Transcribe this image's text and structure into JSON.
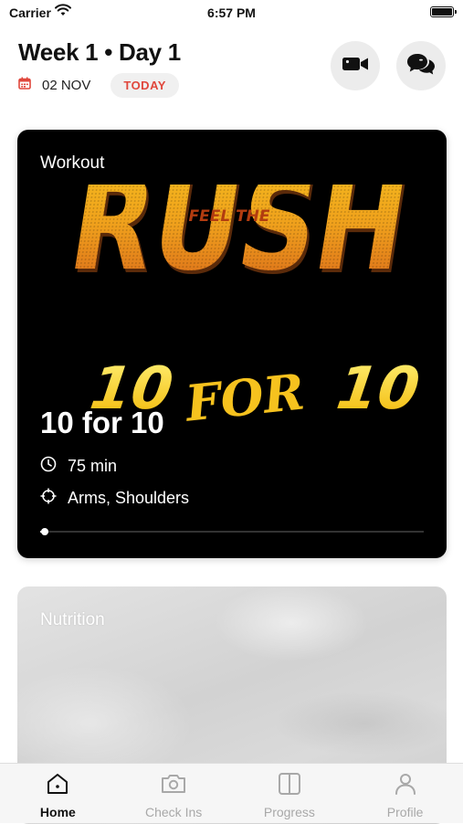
{
  "status_bar": {
    "carrier": "Carrier",
    "time": "6:57 PM"
  },
  "header": {
    "title": "Week 1 • Day 1",
    "date": "02 NOV",
    "today_label": "TODAY",
    "video_icon": "video-camera-icon",
    "chat_icon": "chat-bubbles-icon"
  },
  "workout": {
    "section_label": "Workout",
    "banner": {
      "top_word": "RUSH",
      "overlay_words": "FEEL THE",
      "bottom_left": "10",
      "bottom_mid": "FOR",
      "bottom_right": "10"
    },
    "name": "10 for 10",
    "duration": "75 min",
    "focus": "Arms, Shoulders",
    "progress": 0.01
  },
  "nutrition": {
    "section_label": "Nutrition"
  },
  "tabs": [
    {
      "label": "Home",
      "icon": "home-icon",
      "active": true
    },
    {
      "label": "Check Ins",
      "icon": "camera-icon",
      "active": false
    },
    {
      "label": "Progress",
      "icon": "compare-icon",
      "active": false
    },
    {
      "label": "Profile",
      "icon": "person-icon",
      "active": false
    }
  ],
  "colors": {
    "accent_red": "#e0473c",
    "hero_yellow": "#f5c518",
    "hero_orange": "#e87c1e"
  }
}
